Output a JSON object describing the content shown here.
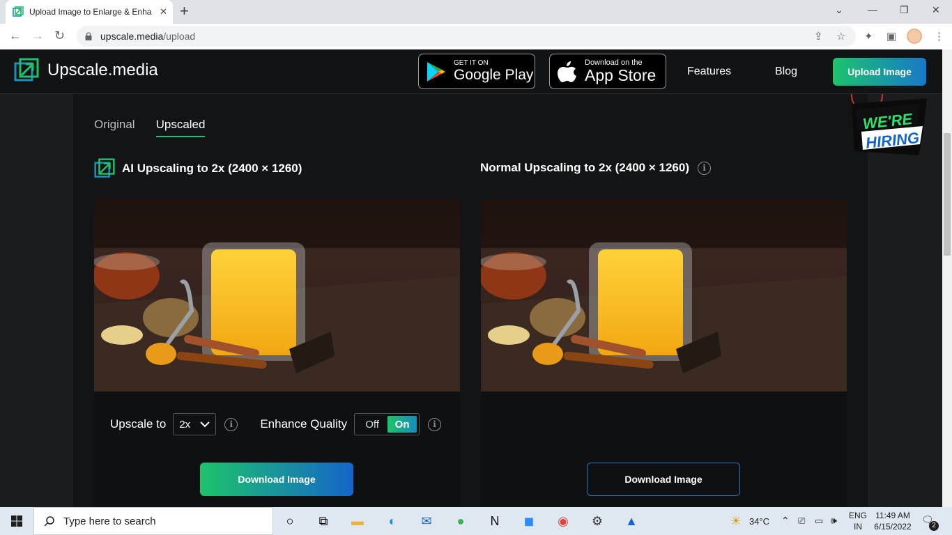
{
  "browser": {
    "tab_title": "Upload Image to Enlarge & Enha",
    "tab_close": "✕",
    "new_tab": "+",
    "url_host": "upscale.media",
    "url_path": "/upload"
  },
  "header": {
    "logo_text": "Upscale.media",
    "google_play_small": "GET IT ON",
    "google_play_big": "Google Play",
    "app_store_small": "Download on the",
    "app_store_big": "App Store",
    "nav_features": "Features",
    "nav_blog": "Blog",
    "upload_button": "Upload Image"
  },
  "hiring_badge": {
    "line1": "WE'RE",
    "line2": "HIRING"
  },
  "tabs": [
    {
      "label": "Original",
      "active": false
    },
    {
      "label": "Upscaled",
      "active": true
    }
  ],
  "ai_panel": {
    "title": "AI Upscaling to 2x (2400 × 1260)",
    "upscale_label": "Upscale to",
    "upscale_value": "2x",
    "enhance_label": "Enhance Quality",
    "toggle_off": "Off",
    "toggle_on": "On",
    "download_label": "Download Image"
  },
  "normal_panel": {
    "title": "Normal Upscaling to 2x (2400 × 1260)",
    "download_label": "Download Image"
  },
  "info_glyph": "i",
  "taskbar": {
    "search_placeholder": "Type here to search",
    "weather": "34°C",
    "lang_top": "ENG",
    "lang_bottom": "IN",
    "time": "11:49 AM",
    "date": "6/15/2022",
    "notification_count": "2"
  },
  "colors": {
    "accent_green": "#1dc36c",
    "accent_blue": "#1565c8",
    "header_bg": "#121314",
    "page_bg": "#1b1c1e"
  }
}
